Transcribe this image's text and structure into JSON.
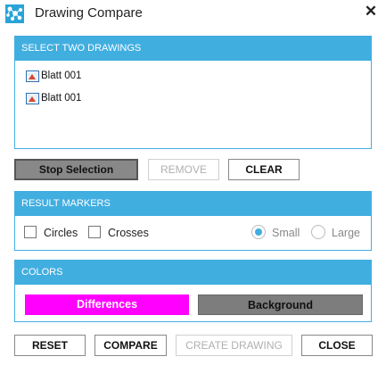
{
  "window": {
    "title": "Drawing Compare",
    "close_glyph": "✕",
    "app_icon": "network-nodes-icon"
  },
  "drawings": {
    "header": "SELECT TWO DRAWINGS",
    "items": [
      {
        "label": "Blatt 001",
        "icon": "drawing-sheet-icon"
      },
      {
        "label": "Blatt 001",
        "icon": "drawing-sheet-icon"
      }
    ]
  },
  "selection_buttons": {
    "stop_selection": "Stop Selection",
    "remove": "REMOVE",
    "clear": "CLEAR"
  },
  "result_markers": {
    "header": "RESULT MARKERS",
    "circles": {
      "label": "Circles",
      "checked": false
    },
    "crosses": {
      "label": "Crosses",
      "checked": false
    },
    "size_options": [
      {
        "label": "Small",
        "selected": true,
        "enabled": false
      },
      {
        "label": "Large",
        "selected": false,
        "enabled": false
      }
    ]
  },
  "colors": {
    "header": "COLORS",
    "differences": {
      "label": "Differences",
      "color": "#ff00ff",
      "text_color": "#ffffff"
    },
    "background": {
      "label": "Background",
      "color": "#7d7d7d",
      "text_color": "#111111"
    }
  },
  "footer_buttons": {
    "reset": "RESET",
    "compare": "COMPARE",
    "create_drawing": "CREATE DRAWING",
    "close": "CLOSE"
  },
  "theme": {
    "accent": "#41aee0"
  }
}
